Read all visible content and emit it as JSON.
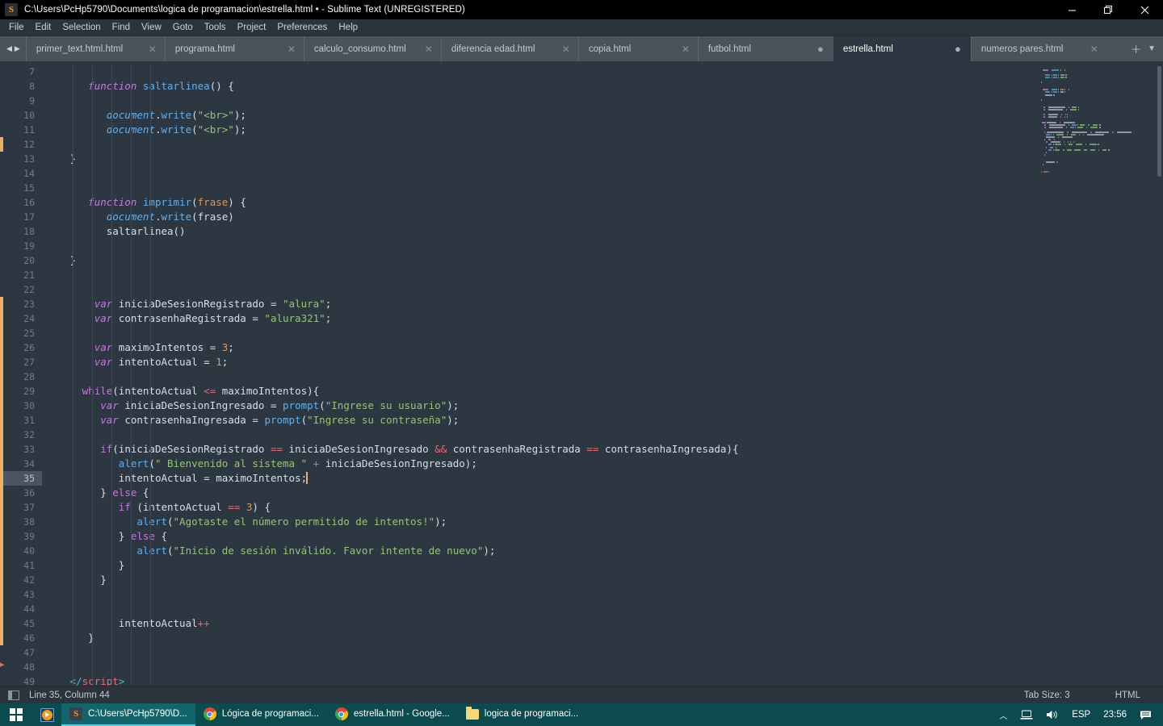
{
  "window": {
    "title": "C:\\Users\\PcHp5790\\Documents\\logica de programacion\\estrella.html • - Sublime Text (UNREGISTERED)",
    "app_icon_glyph": "S",
    "minimize_label": "—",
    "maximize_label": "❐",
    "close_label": "✕"
  },
  "menubar": {
    "items": [
      {
        "label": "File"
      },
      {
        "label": "Edit"
      },
      {
        "label": "Selection"
      },
      {
        "label": "Find"
      },
      {
        "label": "View"
      },
      {
        "label": "Goto"
      },
      {
        "label": "Tools"
      },
      {
        "label": "Project"
      },
      {
        "label": "Preferences"
      },
      {
        "label": "Help"
      }
    ]
  },
  "tabbar": {
    "nav_prev": "◀",
    "nav_next": "▶",
    "add_label": "＋",
    "menu_label": "▼",
    "close_glyph": "✕",
    "dirty_glyph": "●",
    "tabs": [
      {
        "label": "primer_text.html.html",
        "active": false,
        "dirty": false
      },
      {
        "label": "programa.html",
        "active": false,
        "dirty": false
      },
      {
        "label": "calculo_consumo.html",
        "active": false,
        "dirty": false
      },
      {
        "label": "diferencia edad.html",
        "active": false,
        "dirty": false
      },
      {
        "label": "copia.html",
        "active": false,
        "dirty": false
      },
      {
        "label": "futbol.html",
        "active": false,
        "dirty": true
      },
      {
        "label": "estrella.html",
        "active": true,
        "dirty": true
      },
      {
        "label": "numeros pares.html",
        "active": false,
        "dirty": false
      }
    ]
  },
  "editor": {
    "first_line_number": 7,
    "active_line": 35,
    "fold_arrow_glyph": "▸",
    "lines": [
      {
        "n": 7,
        "tokens": []
      },
      {
        "n": 8,
        "tokens": [
          {
            "t": "      ",
            "c": "t-plain"
          },
          {
            "t": "function",
            "c": "t-kw"
          },
          {
            "t": " ",
            "c": "t-plain"
          },
          {
            "t": "saltarlinea",
            "c": "t-fn"
          },
          {
            "t": "() {",
            "c": "t-punc"
          }
        ]
      },
      {
        "n": 9,
        "tokens": []
      },
      {
        "n": 10,
        "tokens": [
          {
            "t": "         ",
            "c": "t-plain"
          },
          {
            "t": "document",
            "c": "t-obj"
          },
          {
            "t": ".",
            "c": "t-punc"
          },
          {
            "t": "write",
            "c": "t-fn"
          },
          {
            "t": "(",
            "c": "t-punc"
          },
          {
            "t": "\"<br>\"",
            "c": "t-str"
          },
          {
            "t": ");",
            "c": "t-punc"
          }
        ]
      },
      {
        "n": 11,
        "tokens": [
          {
            "t": "         ",
            "c": "t-plain"
          },
          {
            "t": "document",
            "c": "t-obj"
          },
          {
            "t": ".",
            "c": "t-punc"
          },
          {
            "t": "write",
            "c": "t-fn"
          },
          {
            "t": "(",
            "c": "t-punc"
          },
          {
            "t": "\"<br>\"",
            "c": "t-str"
          },
          {
            "t": ");",
            "c": "t-punc"
          }
        ]
      },
      {
        "n": 12,
        "tokens": []
      },
      {
        "n": 13,
        "tokens": [
          {
            "t": "   ",
            "c": "t-plain"
          },
          {
            "t": "}",
            "c": "t-punc"
          }
        ]
      },
      {
        "n": 14,
        "tokens": []
      },
      {
        "n": 15,
        "tokens": []
      },
      {
        "n": 16,
        "tokens": [
          {
            "t": "      ",
            "c": "t-plain"
          },
          {
            "t": "function",
            "c": "t-kw"
          },
          {
            "t": " ",
            "c": "t-plain"
          },
          {
            "t": "imprimir",
            "c": "t-fn"
          },
          {
            "t": "(",
            "c": "t-punc"
          },
          {
            "t": "frase",
            "c": "t-param"
          },
          {
            "t": ") {",
            "c": "t-punc"
          }
        ]
      },
      {
        "n": 17,
        "tokens": [
          {
            "t": "         ",
            "c": "t-plain"
          },
          {
            "t": "document",
            "c": "t-obj"
          },
          {
            "t": ".",
            "c": "t-punc"
          },
          {
            "t": "write",
            "c": "t-fn"
          },
          {
            "t": "(",
            "c": "t-punc"
          },
          {
            "t": "frase",
            "c": "t-plain"
          },
          {
            "t": ")",
            "c": "t-punc"
          }
        ]
      },
      {
        "n": 18,
        "tokens": [
          {
            "t": "         ",
            "c": "t-plain"
          },
          {
            "t": "saltarlinea",
            "c": "t-plain"
          },
          {
            "t": "()",
            "c": "t-punc"
          }
        ]
      },
      {
        "n": 19,
        "tokens": []
      },
      {
        "n": 20,
        "tokens": [
          {
            "t": "   ",
            "c": "t-plain"
          },
          {
            "t": "}",
            "c": "t-punc"
          }
        ]
      },
      {
        "n": 21,
        "tokens": []
      },
      {
        "n": 22,
        "tokens": []
      },
      {
        "n": 23,
        "tokens": [
          {
            "t": "       ",
            "c": "t-plain"
          },
          {
            "t": "var",
            "c": "t-kw"
          },
          {
            "t": " iniciaDeSesionRegistrado ",
            "c": "t-plain"
          },
          {
            "t": "=",
            "c": "t-plain"
          },
          {
            "t": " ",
            "c": "t-plain"
          },
          {
            "t": "\"alura\"",
            "c": "t-str"
          },
          {
            "t": ";",
            "c": "t-punc"
          }
        ]
      },
      {
        "n": 24,
        "tokens": [
          {
            "t": "       ",
            "c": "t-plain"
          },
          {
            "t": "var",
            "c": "t-kw"
          },
          {
            "t": " contrasenhaRegistrada ",
            "c": "t-plain"
          },
          {
            "t": "=",
            "c": "t-plain"
          },
          {
            "t": " ",
            "c": "t-plain"
          },
          {
            "t": "\"alura321\"",
            "c": "t-str"
          },
          {
            "t": ";",
            "c": "t-punc"
          }
        ]
      },
      {
        "n": 25,
        "tokens": []
      },
      {
        "n": 26,
        "tokens": [
          {
            "t": "       ",
            "c": "t-plain"
          },
          {
            "t": "var",
            "c": "t-kw"
          },
          {
            "t": " maximoIntentos ",
            "c": "t-plain"
          },
          {
            "t": "=",
            "c": "t-plain"
          },
          {
            "t": " ",
            "c": "t-plain"
          },
          {
            "t": "3",
            "c": "t-num"
          },
          {
            "t": ";",
            "c": "t-punc"
          }
        ]
      },
      {
        "n": 27,
        "tokens": [
          {
            "t": "       ",
            "c": "t-plain"
          },
          {
            "t": "var",
            "c": "t-kw"
          },
          {
            "t": " intentoActual ",
            "c": "t-plain"
          },
          {
            "t": "=",
            "c": "t-plain"
          },
          {
            "t": " ",
            "c": "t-plain"
          },
          {
            "t": "1",
            "c": "t-num"
          },
          {
            "t": ";",
            "c": "t-punc"
          }
        ]
      },
      {
        "n": 28,
        "tokens": []
      },
      {
        "n": 29,
        "tokens": [
          {
            "t": "     ",
            "c": "t-plain"
          },
          {
            "t": "while",
            "c": "t-ctl"
          },
          {
            "t": "(intentoActual ",
            "c": "t-punc"
          },
          {
            "t": "<=",
            "c": "t-op"
          },
          {
            "t": " maximoIntentos){",
            "c": "t-punc"
          }
        ]
      },
      {
        "n": 30,
        "tokens": [
          {
            "t": "        ",
            "c": "t-plain"
          },
          {
            "t": "var",
            "c": "t-kw"
          },
          {
            "t": " iniciaDeSesionIngresado ",
            "c": "t-plain"
          },
          {
            "t": "=",
            "c": "t-plain"
          },
          {
            "t": " ",
            "c": "t-plain"
          },
          {
            "t": "prompt",
            "c": "t-fn"
          },
          {
            "t": "(",
            "c": "t-punc"
          },
          {
            "t": "\"Ingrese su usuario\"",
            "c": "t-str"
          },
          {
            "t": ");",
            "c": "t-punc"
          }
        ]
      },
      {
        "n": 31,
        "tokens": [
          {
            "t": "        ",
            "c": "t-plain"
          },
          {
            "t": "var",
            "c": "t-kw"
          },
          {
            "t": " contrasenhaIngresada ",
            "c": "t-plain"
          },
          {
            "t": "=",
            "c": "t-plain"
          },
          {
            "t": " ",
            "c": "t-plain"
          },
          {
            "t": "prompt",
            "c": "t-fn"
          },
          {
            "t": "(",
            "c": "t-punc"
          },
          {
            "t": "\"Ingrese su contraseña\"",
            "c": "t-str"
          },
          {
            "t": ");",
            "c": "t-punc"
          }
        ]
      },
      {
        "n": 32,
        "tokens": []
      },
      {
        "n": 33,
        "tokens": [
          {
            "t": "        ",
            "c": "t-plain"
          },
          {
            "t": "if",
            "c": "t-ctl"
          },
          {
            "t": "(iniciaDeSesionRegistrado ",
            "c": "t-punc"
          },
          {
            "t": "==",
            "c": "t-op"
          },
          {
            "t": " iniciaDeSesionIngresado ",
            "c": "t-punc"
          },
          {
            "t": "&&",
            "c": "t-op"
          },
          {
            "t": " contrasenhaRegistrada ",
            "c": "t-punc"
          },
          {
            "t": "==",
            "c": "t-op"
          },
          {
            "t": " contrasenhaIngresada){",
            "c": "t-punc"
          }
        ]
      },
      {
        "n": 34,
        "tokens": [
          {
            "t": "           ",
            "c": "t-plain"
          },
          {
            "t": "alert",
            "c": "t-fn"
          },
          {
            "t": "(",
            "c": "t-punc"
          },
          {
            "t": "\" Bienvenido al sistema \"",
            "c": "t-str"
          },
          {
            "t": " ",
            "c": "t-plain"
          },
          {
            "t": "+",
            "c": "t-op"
          },
          {
            "t": " iniciaDeSesionIngresado);",
            "c": "t-punc"
          }
        ]
      },
      {
        "n": 35,
        "tokens": [
          {
            "t": "           ",
            "c": "t-plain"
          },
          {
            "t": "intentoActual ",
            "c": "t-plain"
          },
          {
            "t": "=",
            "c": "t-plain"
          },
          {
            "t": " maximoIntentos;",
            "c": "t-plain"
          }
        ],
        "caret": true
      },
      {
        "n": 36,
        "tokens": [
          {
            "t": "        ",
            "c": "t-plain"
          },
          {
            "t": "}",
            "c": "t-punc"
          },
          {
            "t": " ",
            "c": "t-plain"
          },
          {
            "t": "else",
            "c": "t-ctl"
          },
          {
            "t": " {",
            "c": "t-punc"
          }
        ]
      },
      {
        "n": 37,
        "tokens": [
          {
            "t": "           ",
            "c": "t-plain"
          },
          {
            "t": "if",
            "c": "t-ctl"
          },
          {
            "t": " (intentoActual ",
            "c": "t-punc"
          },
          {
            "t": "==",
            "c": "t-op"
          },
          {
            "t": " ",
            "c": "t-punc"
          },
          {
            "t": "3",
            "c": "t-num"
          },
          {
            "t": ") {",
            "c": "t-punc"
          }
        ]
      },
      {
        "n": 38,
        "tokens": [
          {
            "t": "              ",
            "c": "t-plain"
          },
          {
            "t": "alert",
            "c": "t-fn"
          },
          {
            "t": "(",
            "c": "t-punc"
          },
          {
            "t": "\"Agotaste el número permitido de intentos!\"",
            "c": "t-str"
          },
          {
            "t": ");",
            "c": "t-punc"
          }
        ]
      },
      {
        "n": 39,
        "tokens": [
          {
            "t": "           ",
            "c": "t-plain"
          },
          {
            "t": "}",
            "c": "t-punc"
          },
          {
            "t": " ",
            "c": "t-plain"
          },
          {
            "t": "else",
            "c": "t-ctl"
          },
          {
            "t": " {",
            "c": "t-punc"
          }
        ]
      },
      {
        "n": 40,
        "tokens": [
          {
            "t": "              ",
            "c": "t-plain"
          },
          {
            "t": "alert",
            "c": "t-fn"
          },
          {
            "t": "(",
            "c": "t-punc"
          },
          {
            "t": "\"Inicio de sesión inválido. Favor intente de nuevo\"",
            "c": "t-str"
          },
          {
            "t": ");",
            "c": "t-punc"
          }
        ]
      },
      {
        "n": 41,
        "tokens": [
          {
            "t": "           ",
            "c": "t-plain"
          },
          {
            "t": "}",
            "c": "t-punc"
          }
        ]
      },
      {
        "n": 42,
        "tokens": [
          {
            "t": "        ",
            "c": "t-plain"
          },
          {
            "t": "}",
            "c": "t-punc"
          }
        ]
      },
      {
        "n": 43,
        "tokens": []
      },
      {
        "n": 44,
        "tokens": []
      },
      {
        "n": 45,
        "tokens": [
          {
            "t": "           ",
            "c": "t-plain"
          },
          {
            "t": "intentoActual",
            "c": "t-plain"
          },
          {
            "t": "++",
            "c": "t-op"
          }
        ]
      },
      {
        "n": 46,
        "tokens": [
          {
            "t": "      ",
            "c": "t-plain"
          },
          {
            "t": "}",
            "c": "t-punc"
          }
        ]
      },
      {
        "n": 47,
        "tokens": []
      },
      {
        "n": 48,
        "tokens": []
      },
      {
        "n": 49,
        "tokens": [
          {
            "t": "   ",
            "c": "t-plain"
          },
          {
            "t": "</",
            "c": "t-brack"
          },
          {
            "t": "script",
            "c": "t-tag"
          },
          {
            "t": ">",
            "c": "t-brack"
          }
        ]
      }
    ]
  },
  "statusbar": {
    "cursor_position": "Line 35, Column 44",
    "tab_size": "Tab Size: 3",
    "syntax": "HTML"
  },
  "taskbar": {
    "start_label": "Start",
    "tasks": [
      {
        "label": "C:\\Users\\PcHp5790\\D...",
        "icon": "sublime-icon",
        "active": true
      },
      {
        "label": "Lógica de programaci...",
        "icon": "chrome-icon",
        "active": false
      },
      {
        "label": "estrella.html - Google...",
        "icon": "chrome-icon",
        "active": false
      },
      {
        "label": "logica de programaci...",
        "icon": "folder-icon",
        "active": false
      }
    ],
    "tray": {
      "chevron": "︿",
      "network": "network-icon",
      "volume": "volume-icon",
      "language": "ESP",
      "clock": "23:56",
      "notifications": "notification-icon"
    }
  },
  "colors": {
    "editor_bg": "#2d3742",
    "tabbar_bg": "#4a525c",
    "accent_modified": "#e8b163",
    "taskbar_bg": "#0b4a4f",
    "taskbar_active": "#12666b"
  }
}
